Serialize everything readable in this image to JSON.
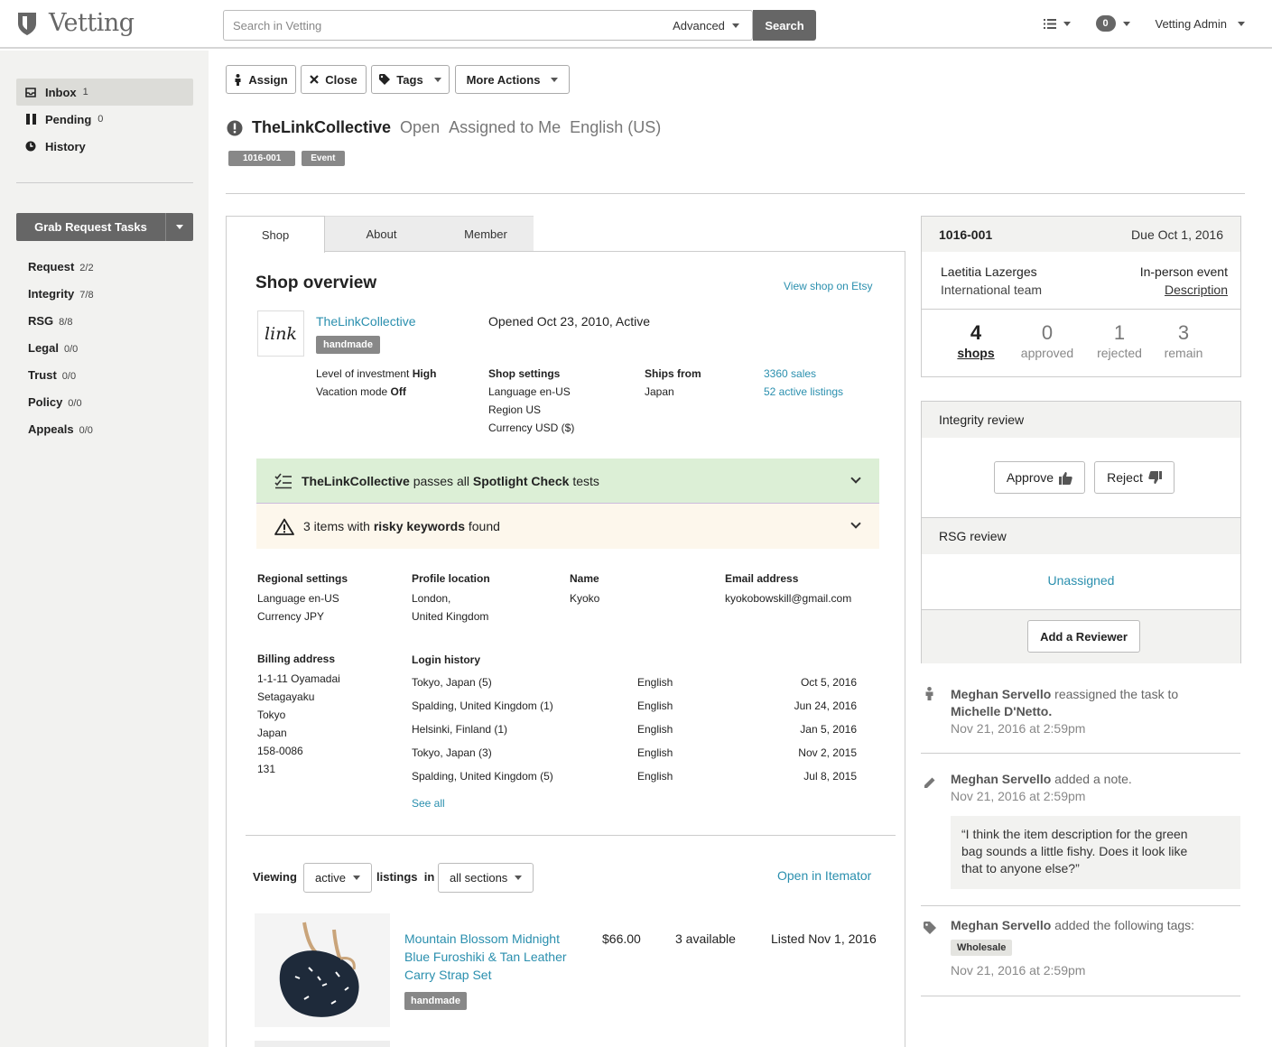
{
  "header": {
    "app_name": "Vetting",
    "search_placeholder": "Search in Vetting",
    "advanced_label": "Advanced",
    "search_button": "Search",
    "notifications_count": "0",
    "user_name": "Vetting Admin"
  },
  "sidebar": {
    "nav": [
      {
        "label": "Inbox",
        "count": "1"
      },
      {
        "label": "Pending",
        "count": "0"
      },
      {
        "label": "History",
        "count": ""
      }
    ],
    "grab_button": "Grab Request Tasks",
    "tasks": [
      {
        "label": "Request",
        "count": "2/2"
      },
      {
        "label": "Integrity",
        "count": "7/8"
      },
      {
        "label": "RSG",
        "count": "8/8"
      },
      {
        "label": "Legal",
        "count": "0/0"
      },
      {
        "label": "Trust",
        "count": "0/0"
      },
      {
        "label": "Policy",
        "count": "0/0"
      },
      {
        "label": "Appeals",
        "count": "0/0"
      }
    ]
  },
  "toolbar": {
    "assign": "Assign",
    "close": "Close",
    "tags": "Tags",
    "more_actions": "More Actions"
  },
  "task": {
    "shop_name": "TheLinkCollective",
    "status": "Open",
    "assignment": "Assigned to Me",
    "locale": "English (US)",
    "tags": [
      "1016-001",
      "Event"
    ]
  },
  "tabs": [
    "Shop",
    "About",
    "Member"
  ],
  "shop": {
    "section_title": "Shop overview",
    "view_link": "View shop on Etsy",
    "logo_text": "link",
    "name": "TheLinkCollective",
    "badge": "handmade",
    "opened": "Opened Oct 23, 2010, Active",
    "investment_label": "Level of investment",
    "investment_value": "High",
    "vacation_label": "Vacation mode",
    "vacation_value": "Off",
    "settings_title": "Shop settings",
    "settings": [
      "Language en-US",
      "Region US",
      "Currency USD ($)"
    ],
    "ships_title": "Ships from",
    "ships_value": "Japan",
    "sales": "3360 sales",
    "listings": "52 active listings"
  },
  "checks": {
    "spotlight_shop": "TheLinkCollective",
    "spotlight_mid": "passes all",
    "spotlight_bold": "Spotlight Check",
    "spotlight_end": "tests",
    "risky_pre": "3 items with",
    "risky_bold": "risky keywords",
    "risky_end": "found"
  },
  "member": {
    "regional_title": "Regional settings",
    "regional": [
      "Language en-US",
      "Currency JPY"
    ],
    "location_title": "Profile location",
    "location": [
      "London,",
      "United Kingdom"
    ],
    "name_title": "Name",
    "name": "Kyoko",
    "email_title": "Email address",
    "email": "kyokobowskill@gmail.com",
    "billing_title": "Billing address",
    "billing": [
      "1-1-11 Oyamadai",
      "Setagayaku",
      "Tokyo",
      "Japan",
      "158-0086",
      "131"
    ],
    "login_title": "Login history",
    "logins": [
      {
        "place": "Tokyo, Japan (5)",
        "lang": "English",
        "date": "Oct 5, 2016"
      },
      {
        "place": "Spalding, United Kingdom (1)",
        "lang": "English",
        "date": "Jun 24, 2016"
      },
      {
        "place": "Helsinki, Finland (1)",
        "lang": "English",
        "date": "Jan 5, 2016"
      },
      {
        "place": "Tokyo, Japan (3)",
        "lang": "English",
        "date": "Nov 2, 2015"
      },
      {
        "place": "Spalding, United Kingdom (5)",
        "lang": "English",
        "date": "Jul 8, 2015"
      }
    ],
    "see_all": "See all"
  },
  "listings": {
    "viewing_label": "Viewing",
    "state": "active",
    "in_label": "listings",
    "in_word": "in",
    "section": "all sections",
    "open_link": "Open in Itemator",
    "items": [
      {
        "title_lines": [
          "Mountain Blossom Midnight",
          "Blue Furoshiki & Tan Leather",
          "Carry Strap Set"
        ],
        "badge": "handmade",
        "price": "$66.00",
        "available": "3 available",
        "listed": "Listed Nov 1, 2016"
      }
    ]
  },
  "summary": {
    "id": "1016-001",
    "due": "Due Oct 1, 2016",
    "requester": "Laetitia Lazerges",
    "team": "International team",
    "event_type": "In-person event",
    "description_link": "Description",
    "stats": [
      {
        "n": "4",
        "l": "shops"
      },
      {
        "n": "0",
        "l": "approved"
      },
      {
        "n": "1",
        "l": "rejected"
      },
      {
        "n": "3",
        "l": "remain"
      }
    ]
  },
  "review": {
    "integrity_title": "Integrity review",
    "approve": "Approve",
    "reject": "Reject",
    "rsg_title": "RSG review",
    "unassigned": "Unassigned",
    "add_reviewer": "Add a Reviewer"
  },
  "activity": [
    {
      "actor": "Meghan Servello",
      "action": "reassigned the task to",
      "target": "Michelle D'Netto.",
      "time": "Nov 21, 2016 at 2:59pm"
    },
    {
      "actor": "Meghan Servello",
      "action": "added a note.",
      "time": "Nov 21, 2016 at 2:59pm",
      "note_lines": [
        "“I think the item description for the green",
        "bag sounds a little fishy. Does it look like",
        "that to anyone else?”"
      ]
    },
    {
      "actor": "Meghan Servello",
      "action": "added the following tags:",
      "tag": "Wholesale",
      "time": "Nov 21, 2016 at 2:59pm"
    }
  ]
}
